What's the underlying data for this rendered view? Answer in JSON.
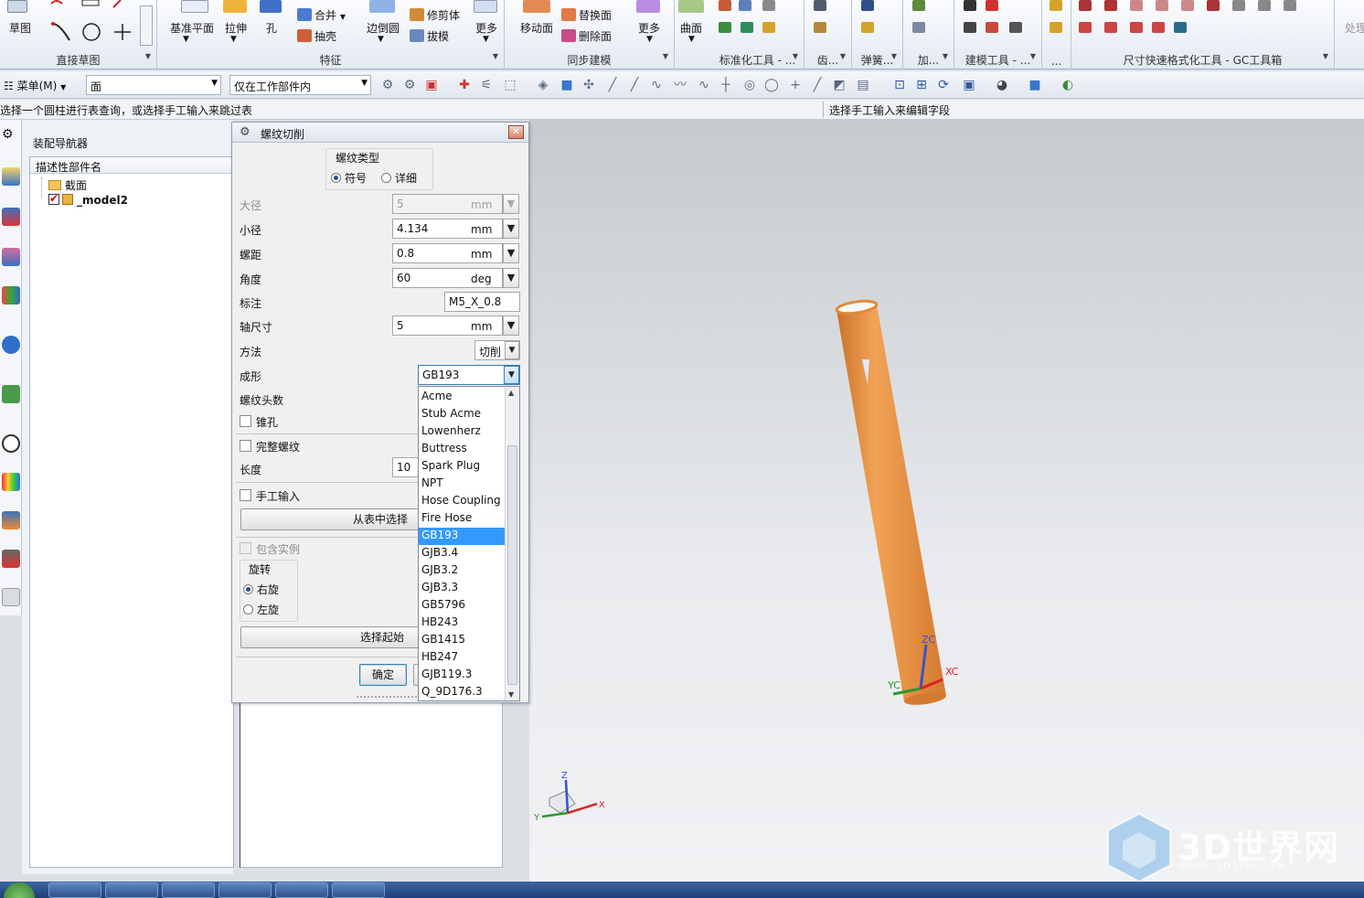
{
  "ribbon": {
    "groups": [
      {
        "label": "直接草图"
      },
      {
        "label": "特征"
      },
      {
        "label": "同步建模"
      },
      {
        "label": "标准化工具 - ..."
      },
      {
        "label": "齿..."
      },
      {
        "label": "弹簧..."
      },
      {
        "label": "加..."
      },
      {
        "label": "建模工具 - ..."
      },
      {
        "label": "..."
      },
      {
        "label": "尺寸快速格式化工具 - GC工具箱"
      }
    ],
    "buttons": {
      "sketch": "草图",
      "datum_plane": "基准平面",
      "extrude": "拉伸",
      "hole": "孔",
      "unite": "合并",
      "shell": "抽壳",
      "edge_blend": "边倒圆",
      "trim_body": "修剪体",
      "draft": "拔模",
      "more1": "更多",
      "move_face": "移动面",
      "replace_face": "替换面",
      "delete_face": "删除面",
      "more2": "更多",
      "surface": "曲面",
      "process": "处理"
    }
  },
  "toolbar": {
    "menu_label": "菜单(M)",
    "selection_filter": "面",
    "selection_scope": "仅在工作部件内"
  },
  "status": {
    "left_prompt": "选择一个圆柱进行表查询，或选择手工输入来跳过表",
    "right_prompt": "选择手工输入来编辑字段"
  },
  "navigator": {
    "title": "装配导航器",
    "column_header": "描述性部件名",
    "items": [
      {
        "label": "截面"
      },
      {
        "label": "_model2"
      }
    ]
  },
  "dialog": {
    "title": "螺纹切削",
    "thread_type_label": "螺纹类型",
    "thread_type_options": [
      "符号",
      "详细"
    ],
    "fields": {
      "major_dia": {
        "label": "大径",
        "value": "5",
        "unit": "mm"
      },
      "minor_dia": {
        "label": "小径",
        "value": "4.134",
        "unit": "mm"
      },
      "pitch": {
        "label": "螺距",
        "value": "0.8",
        "unit": "mm"
      },
      "angle": {
        "label": "角度",
        "value": "60",
        "unit": "deg"
      },
      "callout": {
        "label": "标注",
        "value": "M5_X_0.8"
      },
      "shaft_size": {
        "label": "轴尺寸",
        "value": "5",
        "unit": "mm"
      },
      "method": {
        "label": "方法",
        "value": "切削"
      },
      "form": {
        "label": "成形",
        "value": "GB193"
      },
      "num_starts": {
        "label": "螺纹头数"
      },
      "length": {
        "label": "长度",
        "value": "10"
      }
    },
    "tapered_label": "锥孔",
    "full_thread_label": "完整螺纹",
    "manual_input_label": "手工输入",
    "choose_from_table": "从表中选择",
    "include_instances": "包含实例",
    "rotation_label": "旋转",
    "rotation_options": [
      "右旋",
      "左旋"
    ],
    "select_start": "选择起始",
    "ok": "确定"
  },
  "form_dropdown": {
    "options": [
      "Acme",
      "Stub Acme",
      "Lowenherz",
      "Buttress",
      "Spark Plug",
      "NPT",
      "Hose Coupling",
      "Fire Hose",
      "GB193",
      "GJB3.4",
      "GJB3.2",
      "GJB3.3",
      "GB5796",
      "HB243",
      "GB1415",
      "HB247",
      "GJB119.3",
      "Q_9D176.3"
    ],
    "selected": "GB193"
  },
  "viewport": {
    "csys_labels": {
      "zc": "ZC",
      "xc": "XC",
      "yc": "YC",
      "z": "Z",
      "x": "X",
      "y": "Y"
    },
    "part_color": "#e8923e"
  },
  "watermark": {
    "brand": "3D世界网",
    "url": "WWW.3DSJW.COM"
  }
}
